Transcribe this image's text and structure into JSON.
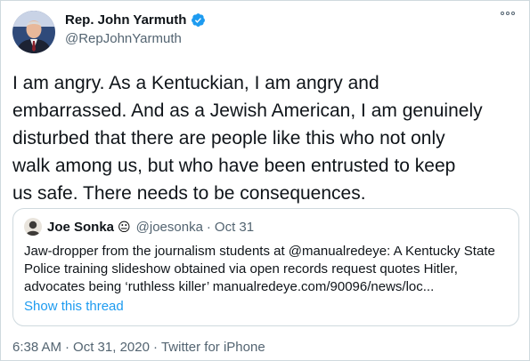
{
  "author": {
    "name": "Rep. John Yarmuth",
    "handle": "@RepJohnYarmuth"
  },
  "tweet_lines": [
    "I am angry. As a Kentuckian, I am angry and",
    "embarrassed. And as a Jewish American, I am genuinely",
    "disturbed that there are people like this who not only",
    "walk among us, but who have been entrusted to keep",
    "us safe. There needs to be consequences."
  ],
  "quote": {
    "name": "Joe Sonka",
    "emoji": "😐",
    "handle": "@joesonka",
    "dot": "·",
    "date": "Oct 31",
    "lines": [
      "Jaw-dropper from the journalism students at @manualredeye: A Kentucky State",
      "Police training slideshow obtained via open records request quotes Hitler,",
      "advocates being ‘ruthless killer’  manualredeye.com/90096/news/loc..."
    ],
    "show_thread": "Show this thread"
  },
  "meta": {
    "time": "6:38 AM",
    "sep1": "·",
    "date": "Oct 31, 2020",
    "sep2": "·",
    "source": "Twitter for iPhone"
  },
  "icons": {
    "verified": "verified-badge-icon",
    "more": "more-options-icon"
  },
  "colors": {
    "text": "#0f1419",
    "secondary": "#536471",
    "link": "#1d9bf0",
    "border": "#cfd9de"
  }
}
